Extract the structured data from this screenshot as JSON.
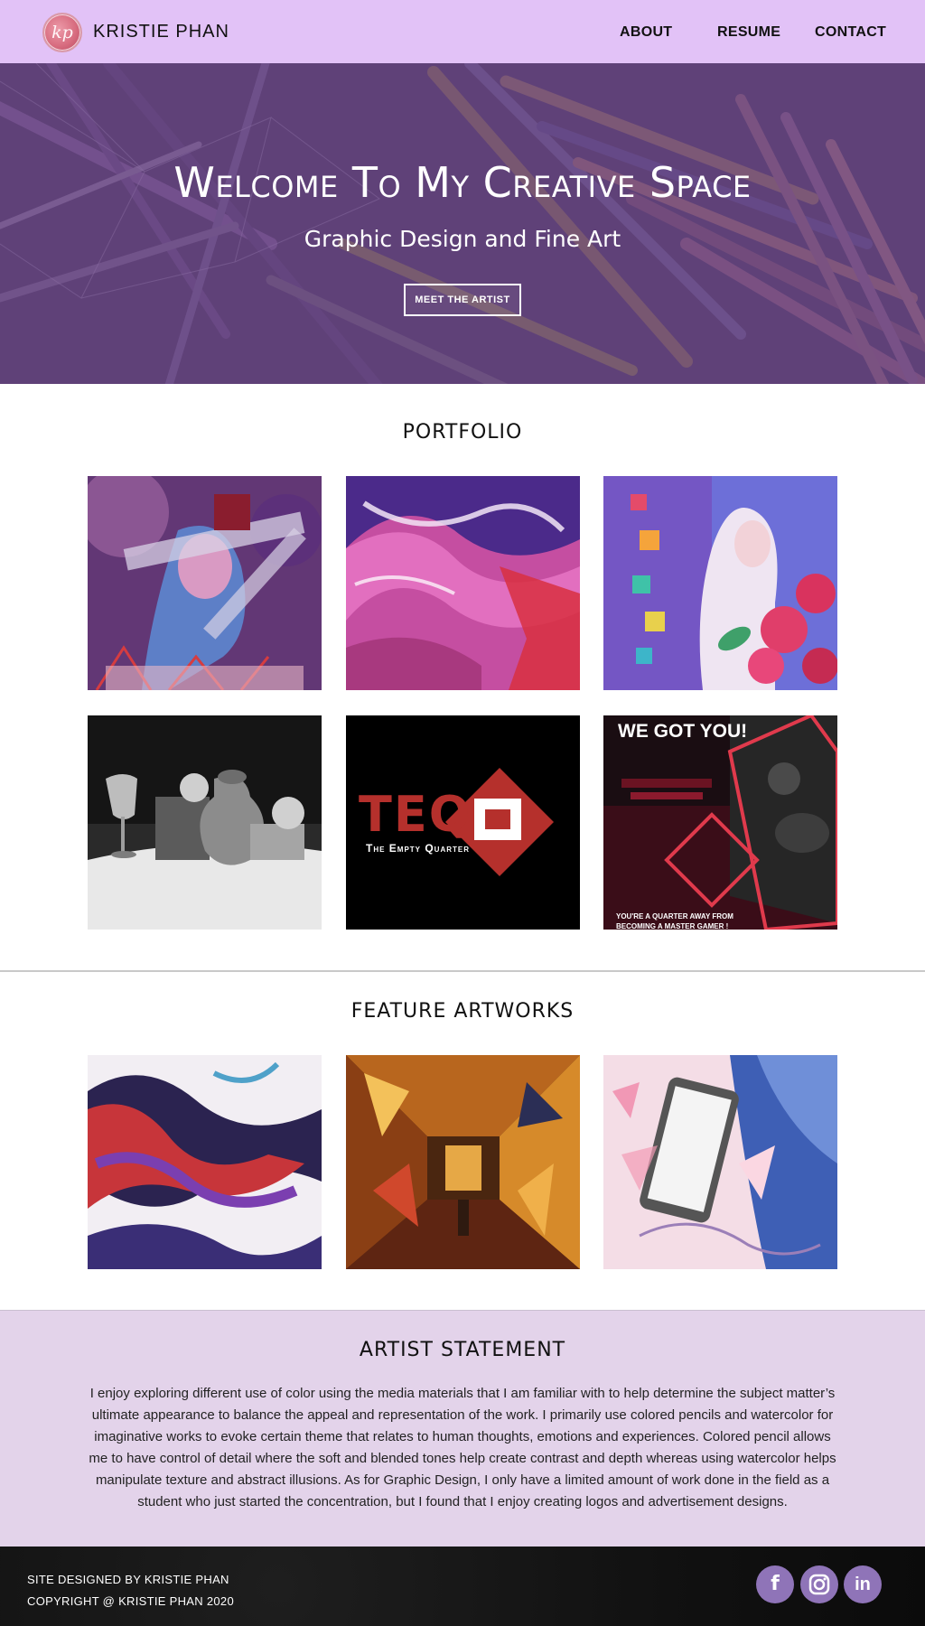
{
  "header": {
    "logo_text": "kp",
    "brand": "KRISTIE PHAN",
    "nav": [
      "ABOUT",
      "RESUME",
      "CONTACT"
    ]
  },
  "hero": {
    "title": "Welcome To My Creative Space",
    "subtitle": "Graphic Design and Fine Art",
    "button": "MEET THE ARTIST"
  },
  "portfolio": {
    "title": "PORTFOLIO",
    "items": [
      {
        "name": "abstract-portrait-artwork"
      },
      {
        "name": "pink-pour-painting-artwork"
      },
      {
        "name": "girl-with-roses-artwork"
      },
      {
        "name": "still-life-charcoal-artwork"
      },
      {
        "name": "teq-logo-artwork",
        "text": "TEQ",
        "caption": "The Empty Quarter"
      },
      {
        "name": "gaming-ad-artwork",
        "headline": "WE GOT YOU!",
        "tagline_1": "YOU'RE A QUARTER AWAY FROM",
        "tagline_2": "BECOMING A MASTER GAMER !"
      }
    ]
  },
  "features": {
    "title": "FEATURE ARTWORKS",
    "items": [
      {
        "name": "abstract-fluid-artwork"
      },
      {
        "name": "mirror-tunnel-artwork"
      },
      {
        "name": "phone-shatter-artwork"
      }
    ]
  },
  "statement": {
    "title": "ARTIST STATEMENT",
    "text": "I enjoy exploring different use of color using the media materials that I am familiar with to help determine the subject matter’s ultimate appearance to balance the appeal and representation of the work. I primarily use colored pencils and watercolor for imaginative works to evoke certain theme that relates to human thoughts, emotions and experiences. Colored pencil allows me to have control of detail where the soft and blended tones help create contrast and depth whereas using watercolor helps manipulate texture and abstract illusions. As for Graphic Design, I only have a limited amount of work done in the field as a student who just started the concentration, but I found that I enjoy creating logos and advertisement designs."
  },
  "footer": {
    "line1": "SITE DESIGNED BY KRISTIE PHAN",
    "line2": "COPYRIGHT @ KRISTIE PHAN 2020",
    "social": [
      "facebook-icon",
      "instagram-icon",
      "linkedin-icon"
    ]
  },
  "colors": {
    "header_bg": "#e2c2f7",
    "hero_overlay": "#603e7c",
    "statement_bg": "#e3d3ea",
    "social_bg": "#8f74b8",
    "footer_bg": "#111111"
  }
}
